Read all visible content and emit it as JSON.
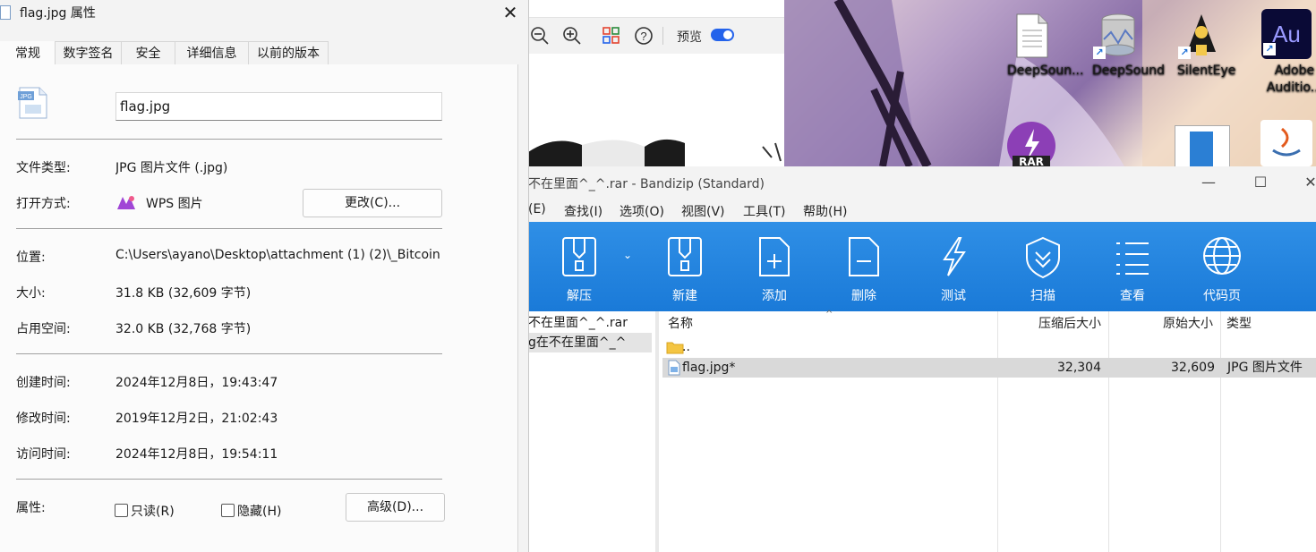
{
  "desktop": {
    "icons": [
      {
        "label": "DeepSoun...",
        "icon": "document-icon"
      },
      {
        "label": "DeepSound",
        "icon": "deepsound-icon"
      },
      {
        "label": "SilentEye",
        "icon": "silenteye-icon"
      },
      {
        "label": "Adobe Auditio...",
        "icon": "adobe-audition-icon",
        "badge": "Au"
      },
      {
        "label": "RAR",
        "icon": "rar-icon"
      }
    ]
  },
  "viewer": {
    "preview_label": "预览",
    "preview_toggle": "on"
  },
  "bandizip": {
    "title": "不在里面^_^.rar - Bandizip (Standard)",
    "menu": [
      "(E)",
      "查找(I)",
      "选项(O)",
      "视图(V)",
      "工具(T)",
      "帮助(H)"
    ],
    "toolbar": [
      "解压",
      "新建",
      "添加",
      "删除",
      "测试",
      "扫描",
      "查看",
      "代码页"
    ],
    "tree": [
      "不在里面^_^.rar",
      "g在不在里面^_^"
    ],
    "columns": {
      "name": "名称",
      "packed": "压缩后大小",
      "original": "原始大小",
      "type": "类型"
    },
    "rows": [
      {
        "name": "..",
        "packed": "",
        "original": "",
        "type": ""
      },
      {
        "name": "flag.jpg*",
        "packed": "32,304",
        "original": "32,609",
        "type": "JPG 图片文件"
      }
    ]
  },
  "properties": {
    "title": "flag.jpg 属性",
    "tabs": [
      "常规",
      "数字签名",
      "安全",
      "详细信息",
      "以前的版本"
    ],
    "filename": "flag.jpg",
    "file_type_label": "文件类型:",
    "file_type": "JPG 图片文件 (.jpg)",
    "open_with_label": "打开方式:",
    "open_with": "WPS 图片",
    "change_button": "更改(C)...",
    "location_label": "位置:",
    "location": "C:\\Users\\ayano\\Desktop\\attachment (1) (2)\\_Bitcoin",
    "size_label": "大小:",
    "size": "31.8 KB (32,609 字节)",
    "disk_size_label": "占用空间:",
    "disk_size": "32.0 KB (32,768 字节)",
    "created_label": "创建时间:",
    "created": "2024年12月8日，19:43:47",
    "modified_label": "修改时间:",
    "modified": "2019年12月2日，21:02:43",
    "accessed_label": "访问时间:",
    "accessed": "2024年12月8日，19:54:11",
    "attributes_label": "属性:",
    "readonly": "只读(R)",
    "hidden": "隐藏(H)",
    "advanced_button": "高级(D)..."
  }
}
